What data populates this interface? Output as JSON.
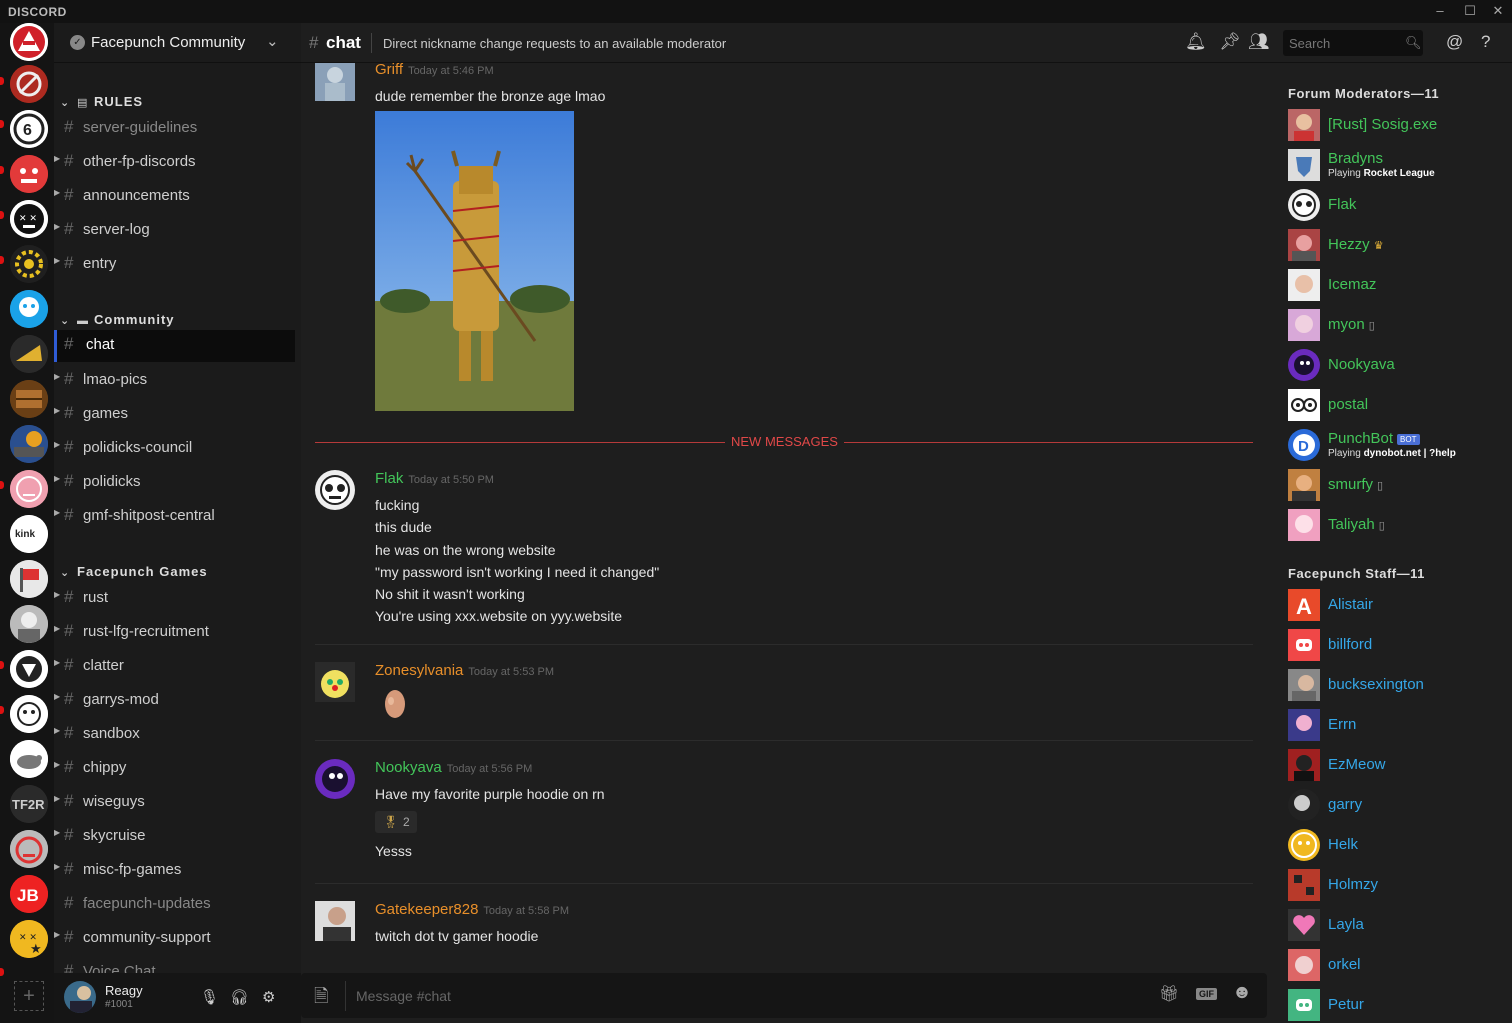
{
  "window": {
    "brand": "DISCORD",
    "minimize": "–",
    "maximize": "☐",
    "close": "✕"
  },
  "guild": {
    "name": "Facepunch Community",
    "verified_glyph": "✓",
    "chevron": "⌄"
  },
  "categories": {
    "rules": {
      "label": "RULES"
    },
    "community": {
      "label": "Community"
    },
    "games": {
      "label": "Facepunch Games"
    }
  },
  "channels": [
    {
      "name": "server-guidelines",
      "muted": true
    },
    {
      "name": "other-fp-discords"
    },
    {
      "name": "announcements"
    },
    {
      "name": "server-log"
    },
    {
      "name": "entry"
    },
    {
      "name": "chat",
      "active": true
    },
    {
      "name": "lmao-pics"
    },
    {
      "name": "games"
    },
    {
      "name": "polidicks-council"
    },
    {
      "name": "polidicks"
    },
    {
      "name": "gmf-shitpost-central"
    },
    {
      "name": "rust"
    },
    {
      "name": "rust-lfg-recruitment"
    },
    {
      "name": "clatter"
    },
    {
      "name": "garrys-mod"
    },
    {
      "name": "sandbox"
    },
    {
      "name": "chippy"
    },
    {
      "name": "wiseguys"
    },
    {
      "name": "skycruise"
    },
    {
      "name": "misc-fp-games"
    },
    {
      "name": "facepunch-updates",
      "muted": true
    },
    {
      "name": "community-support"
    },
    {
      "name": "Voice Chat",
      "muted": true
    }
  ],
  "user": {
    "name": "Reagy",
    "discriminator": "#1001"
  },
  "header": {
    "channel": "chat",
    "topic": "Direct nickname change requests to an available moderator",
    "search_placeholder": "Search"
  },
  "messages": [
    {
      "author": "Griff",
      "color": "#e88f2a",
      "time": "Today at 5:46 PM",
      "lines": [
        "dude remember the bronze age lmao"
      ]
    },
    {
      "author": "Flak",
      "color": "#43c55a",
      "time": "Today at 5:50 PM",
      "lines": [
        "fucking",
        "this dude",
        "he was on the wrong website",
        "\"my password isn't working I need it changed\"",
        "No shit it wasn't working",
        "You're using xxx.website on yyy.website"
      ]
    },
    {
      "author": "Zonesylvania",
      "color": "#e88f2a",
      "time": "Today at 5:53 PM",
      "lines": []
    },
    {
      "author": "Nookyava",
      "color": "#43c55a",
      "time": "Today at 5:56 PM",
      "lines": [
        "Have my favorite purple hoodie on rn"
      ],
      "reaction_count": "2",
      "after": "Yesss"
    },
    {
      "author": "Gatekeeper828",
      "color": "#e88f2a",
      "time": "Today at 5:58 PM",
      "lines": [
        "twitch dot tv gamer hoodie"
      ]
    }
  ],
  "new_messages_label": "NEW MESSAGES",
  "composer": {
    "placeholder": "Message #chat",
    "gif": "GIF"
  },
  "member_groups": [
    {
      "label": "Forum Moderators—11",
      "members": [
        {
          "name": "[Rust] Sosig.exe"
        },
        {
          "name": "Bradyns",
          "activity_prefix": "Playing ",
          "activity": "Rocket League"
        },
        {
          "name": "Flak"
        },
        {
          "name": "Hezzy",
          "crown": true
        },
        {
          "name": "Icemaz"
        },
        {
          "name": "myon",
          "mobile": true
        },
        {
          "name": "Nookyava"
        },
        {
          "name": "postal"
        },
        {
          "name": "PunchBot",
          "bot": "BOT",
          "activity_prefix": "Playing ",
          "activity": "dynobot.net | ?help"
        },
        {
          "name": "smurfy",
          "mobile": true
        },
        {
          "name": "Taliyah",
          "mobile": true
        }
      ]
    },
    {
      "label": "Facepunch Staff—11",
      "members": [
        {
          "name": "Alistair"
        },
        {
          "name": "billford"
        },
        {
          "name": "bucksexington"
        },
        {
          "name": "Errn"
        },
        {
          "name": "EzMeow"
        },
        {
          "name": "garry"
        },
        {
          "name": "Helk"
        },
        {
          "name": "Holmzy"
        },
        {
          "name": "Layla"
        },
        {
          "name": "orkel"
        },
        {
          "name": "Petur"
        }
      ]
    }
  ]
}
